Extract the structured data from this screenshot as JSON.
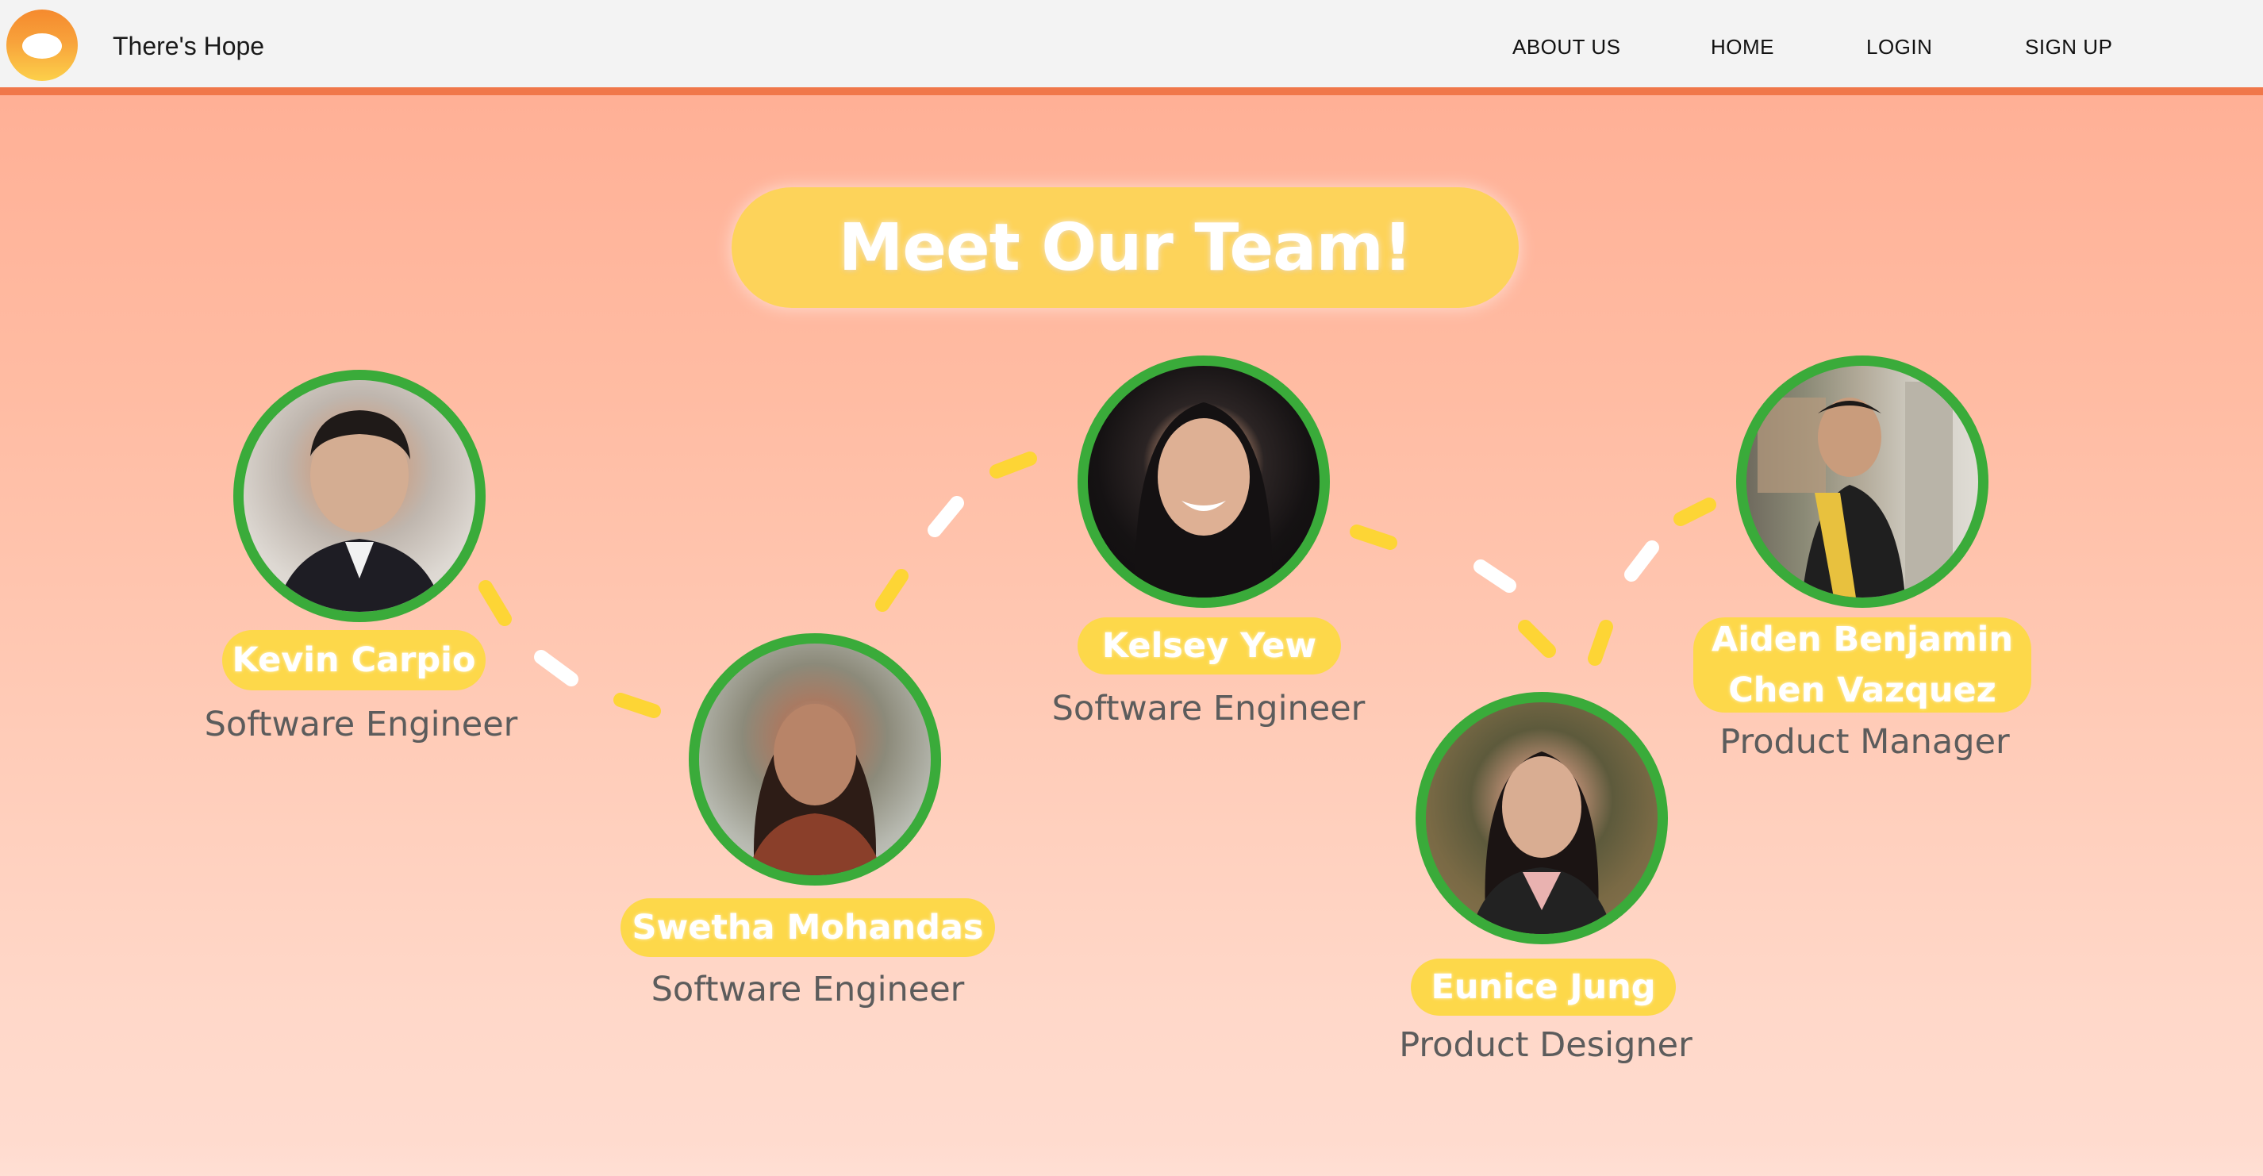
{
  "nav": {
    "brand": "There's Hope",
    "links": [
      "ABOUT US",
      "HOME",
      "LOGIN",
      "SIGN UP"
    ]
  },
  "hero": {
    "title": "Meet Our Team!"
  },
  "team": [
    {
      "name": "Kevin Carpio",
      "role": "Software Engineer"
    },
    {
      "name": "Swetha Mohandas",
      "role": "Software Engineer"
    },
    {
      "name": "Kelsey Yew",
      "role": "Software Engineer"
    },
    {
      "name": "Eunice Jung",
      "role": "Product Designer"
    },
    {
      "name_line1": "Aiden Benjamin",
      "name_line2": "Chen Vazquez",
      "role": "Product Manager"
    }
  ],
  "colors": {
    "nav_accent": "#f0774a",
    "photo_ring": "#3aab3a",
    "name_pill": "#fdd84a",
    "dash_yellow": "#fdd535",
    "dash_white": "#ffffff"
  }
}
